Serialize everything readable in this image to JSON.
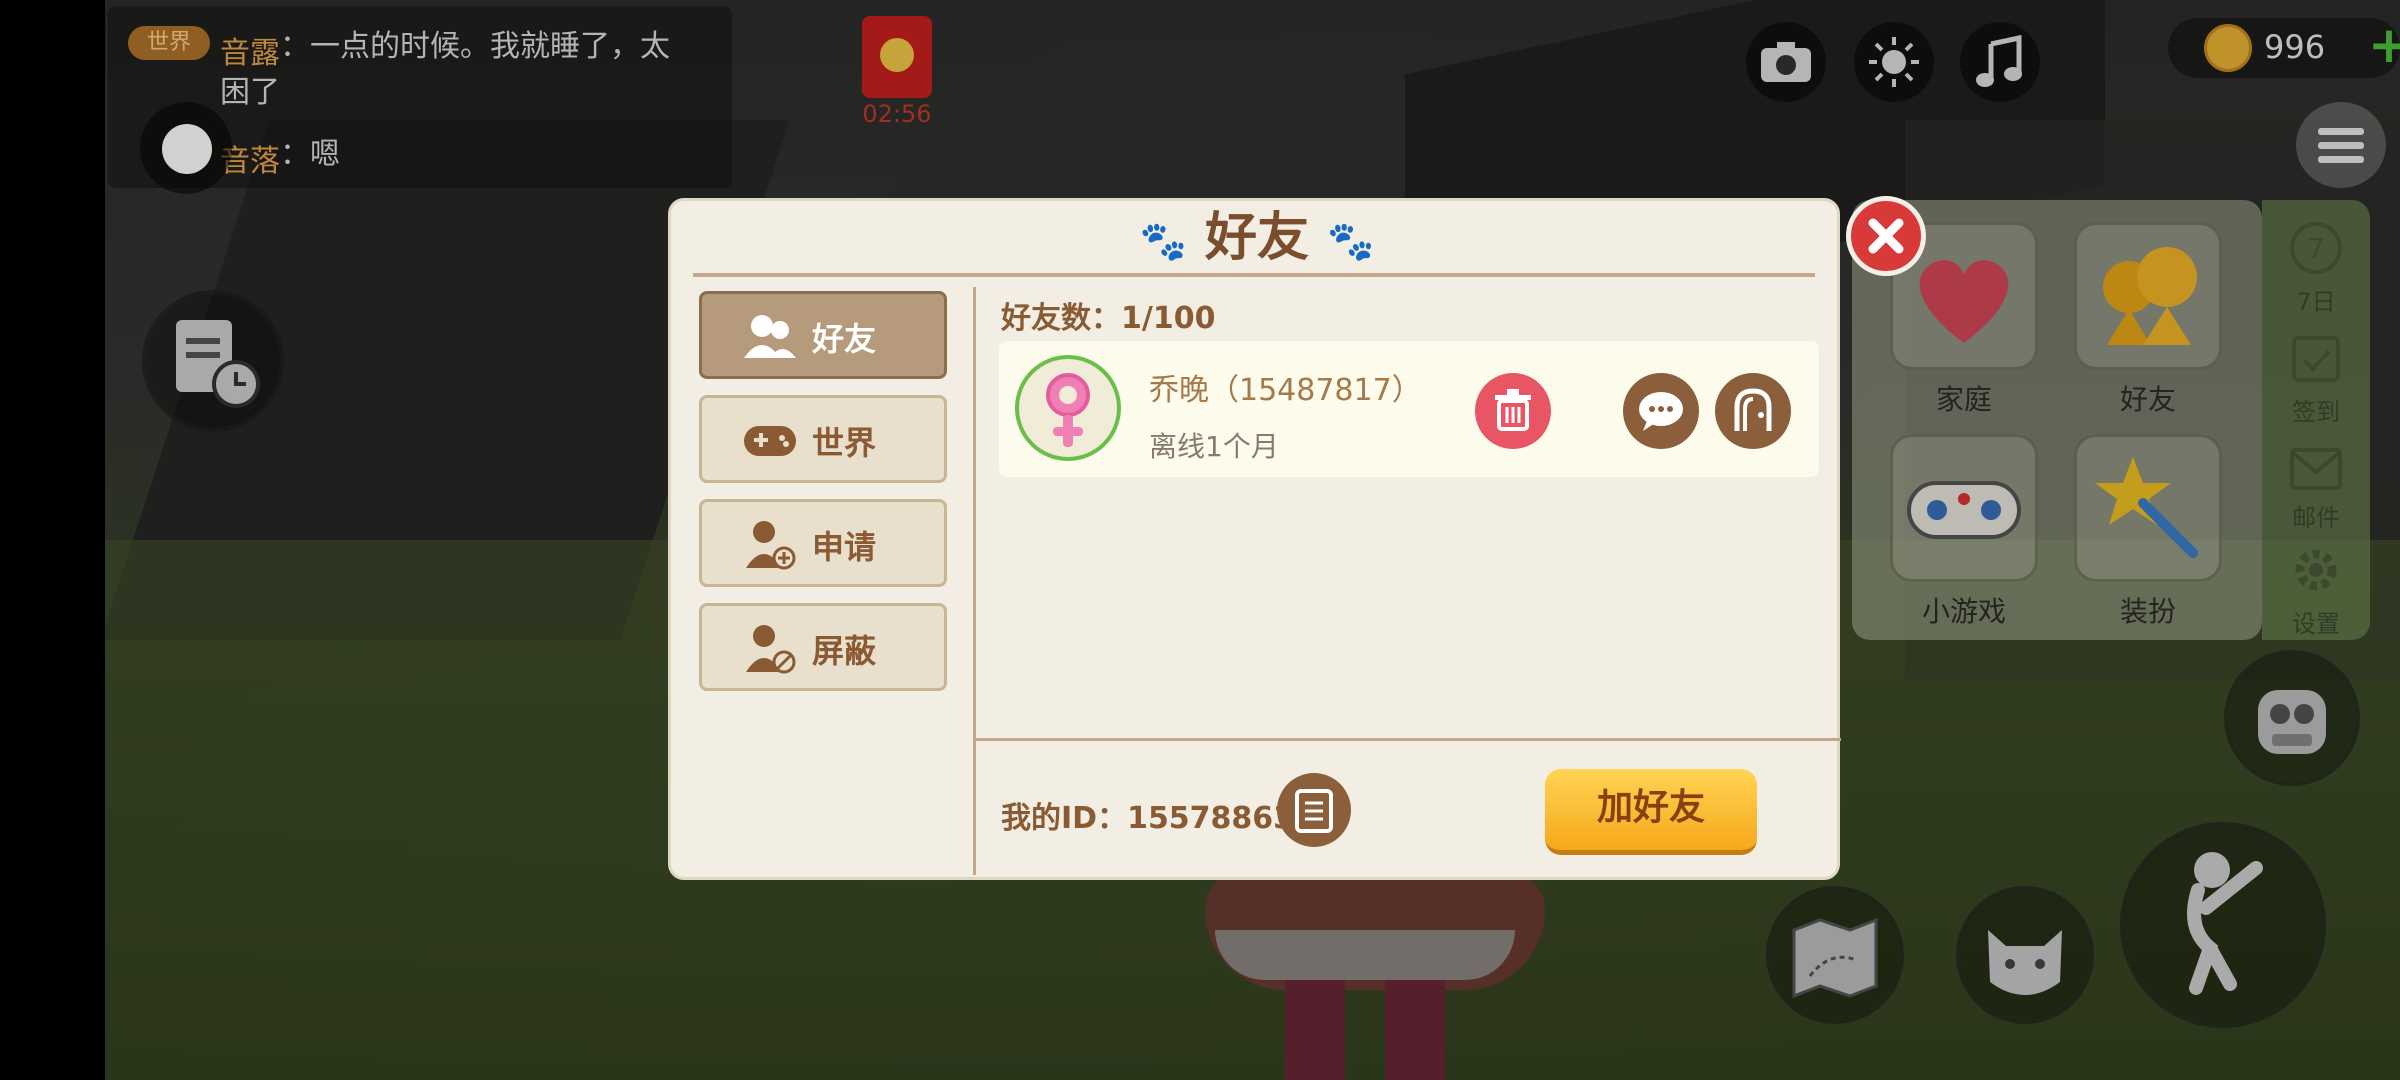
{
  "chat": {
    "tag": "世界",
    "messages": [
      {
        "name": "音露",
        "text": "：一点的时候。我就睡了，太",
        "cont": "困了"
      },
      {
        "name": "音落",
        "text": "：嗯"
      }
    ]
  },
  "red_packet": {
    "timer": "02:56"
  },
  "currency": {
    "coins": "996"
  },
  "quick_menu": {
    "tiles": [
      {
        "label": "家庭"
      },
      {
        "label": "好友"
      },
      {
        "label": "小游戏"
      },
      {
        "label": "装扮"
      }
    ],
    "side": [
      {
        "label": "7日"
      },
      {
        "label": "签到"
      },
      {
        "label": "邮件"
      },
      {
        "label": "设置"
      }
    ]
  },
  "dialog": {
    "title": "好友",
    "tabs": [
      {
        "label": "好友",
        "active": true
      },
      {
        "label": "世界",
        "active": false
      },
      {
        "label": "申请",
        "active": false
      },
      {
        "label": "屏蔽",
        "active": false
      }
    ],
    "friend_count": "好友数：1/100",
    "friends": [
      {
        "name": "乔晚（15487817）",
        "status": "离线1个月",
        "gender": "female"
      }
    ],
    "my_id": "我的ID：15578863",
    "add_button": "加好友"
  },
  "colors": {
    "accent_brown": "#8a5a33",
    "add_button": "#f7a81b",
    "delete": "#e85666",
    "close": "#d83a3a"
  }
}
